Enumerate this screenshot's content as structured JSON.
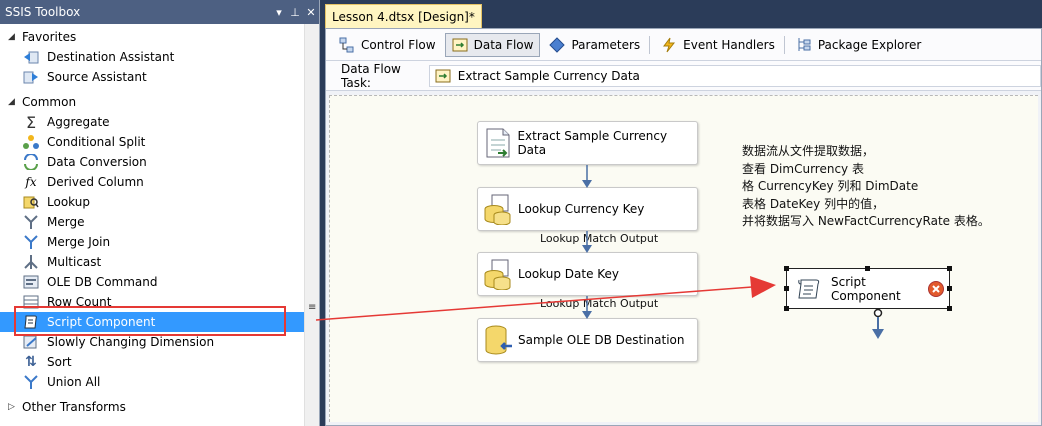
{
  "toolbox": {
    "title": "SSIS Toolbox",
    "controls": [
      "▾",
      "⊥",
      "✕"
    ],
    "groups": [
      {
        "label": "Favorites",
        "expanded": true,
        "items": [
          {
            "label": "Destination Assistant",
            "icon": "destination-assistant-icon"
          },
          {
            "label": "Source Assistant",
            "icon": "source-assistant-icon"
          }
        ]
      },
      {
        "label": "Common",
        "expanded": true,
        "items": [
          {
            "label": "Aggregate",
            "icon": "aggregate-icon"
          },
          {
            "label": "Conditional Split",
            "icon": "conditional-split-icon"
          },
          {
            "label": "Data Conversion",
            "icon": "data-conversion-icon"
          },
          {
            "label": "Derived Column",
            "icon": "derived-column-icon"
          },
          {
            "label": "Lookup",
            "icon": "lookup-icon"
          },
          {
            "label": "Merge",
            "icon": "merge-icon"
          },
          {
            "label": "Merge Join",
            "icon": "merge-join-icon"
          },
          {
            "label": "Multicast",
            "icon": "multicast-icon"
          },
          {
            "label": "OLE DB Command",
            "icon": "ole-db-command-icon"
          },
          {
            "label": "Row Count",
            "icon": "row-count-icon"
          },
          {
            "label": "Script Component",
            "icon": "script-component-icon",
            "selected": true
          },
          {
            "label": "Slowly Changing Dimension",
            "icon": "slowly-changing-dimension-icon"
          },
          {
            "label": "Sort",
            "icon": "sort-icon"
          },
          {
            "label": "Union All",
            "icon": "union-all-icon"
          }
        ]
      },
      {
        "label": "Other Transforms",
        "expanded": false,
        "items": []
      }
    ]
  },
  "document": {
    "tab_title": "Lesson 4.dtsx [Design]*",
    "tabs": [
      {
        "label": "Control Flow",
        "icon": "control-flow-icon"
      },
      {
        "label": "Data Flow",
        "icon": "data-flow-icon",
        "active": true
      },
      {
        "label": "Parameters",
        "icon": "parameters-icon"
      },
      {
        "label": "Event Handlers",
        "icon": "event-handlers-icon"
      },
      {
        "label": "Package Explorer",
        "icon": "package-explorer-icon"
      }
    ],
    "task_label": "Data Flow Task:",
    "task_value": "Extract Sample Currency Data"
  },
  "canvas": {
    "components": [
      {
        "label": "Extract Sample Currency Data",
        "icon": "flat-file-source-icon"
      },
      {
        "label": "Lookup Currency Key",
        "icon": "lookup-db-icon"
      },
      {
        "label": "Lookup Date Key",
        "icon": "lookup-db-icon"
      },
      {
        "label": "Sample OLE DB Destination",
        "icon": "ole-db-destination-icon"
      }
    ],
    "path_labels": [
      "Lookup Match Output",
      "Lookup Match Output"
    ],
    "note": "数据流从文件提取数据，\n查看 DimCurrency 表\n格 CurrencyKey 列和 DimDate\n表格 DateKey 列中的值，\n并将数据写入 NewFactCurrencyRate 表格。",
    "script_component": {
      "label": "Script Component",
      "status": "error"
    }
  },
  "colors": {
    "selection": "#3399ff",
    "highlight": "#e53935",
    "title_bar": "#4d6082",
    "flow_arrow": "#4a6fa5"
  }
}
